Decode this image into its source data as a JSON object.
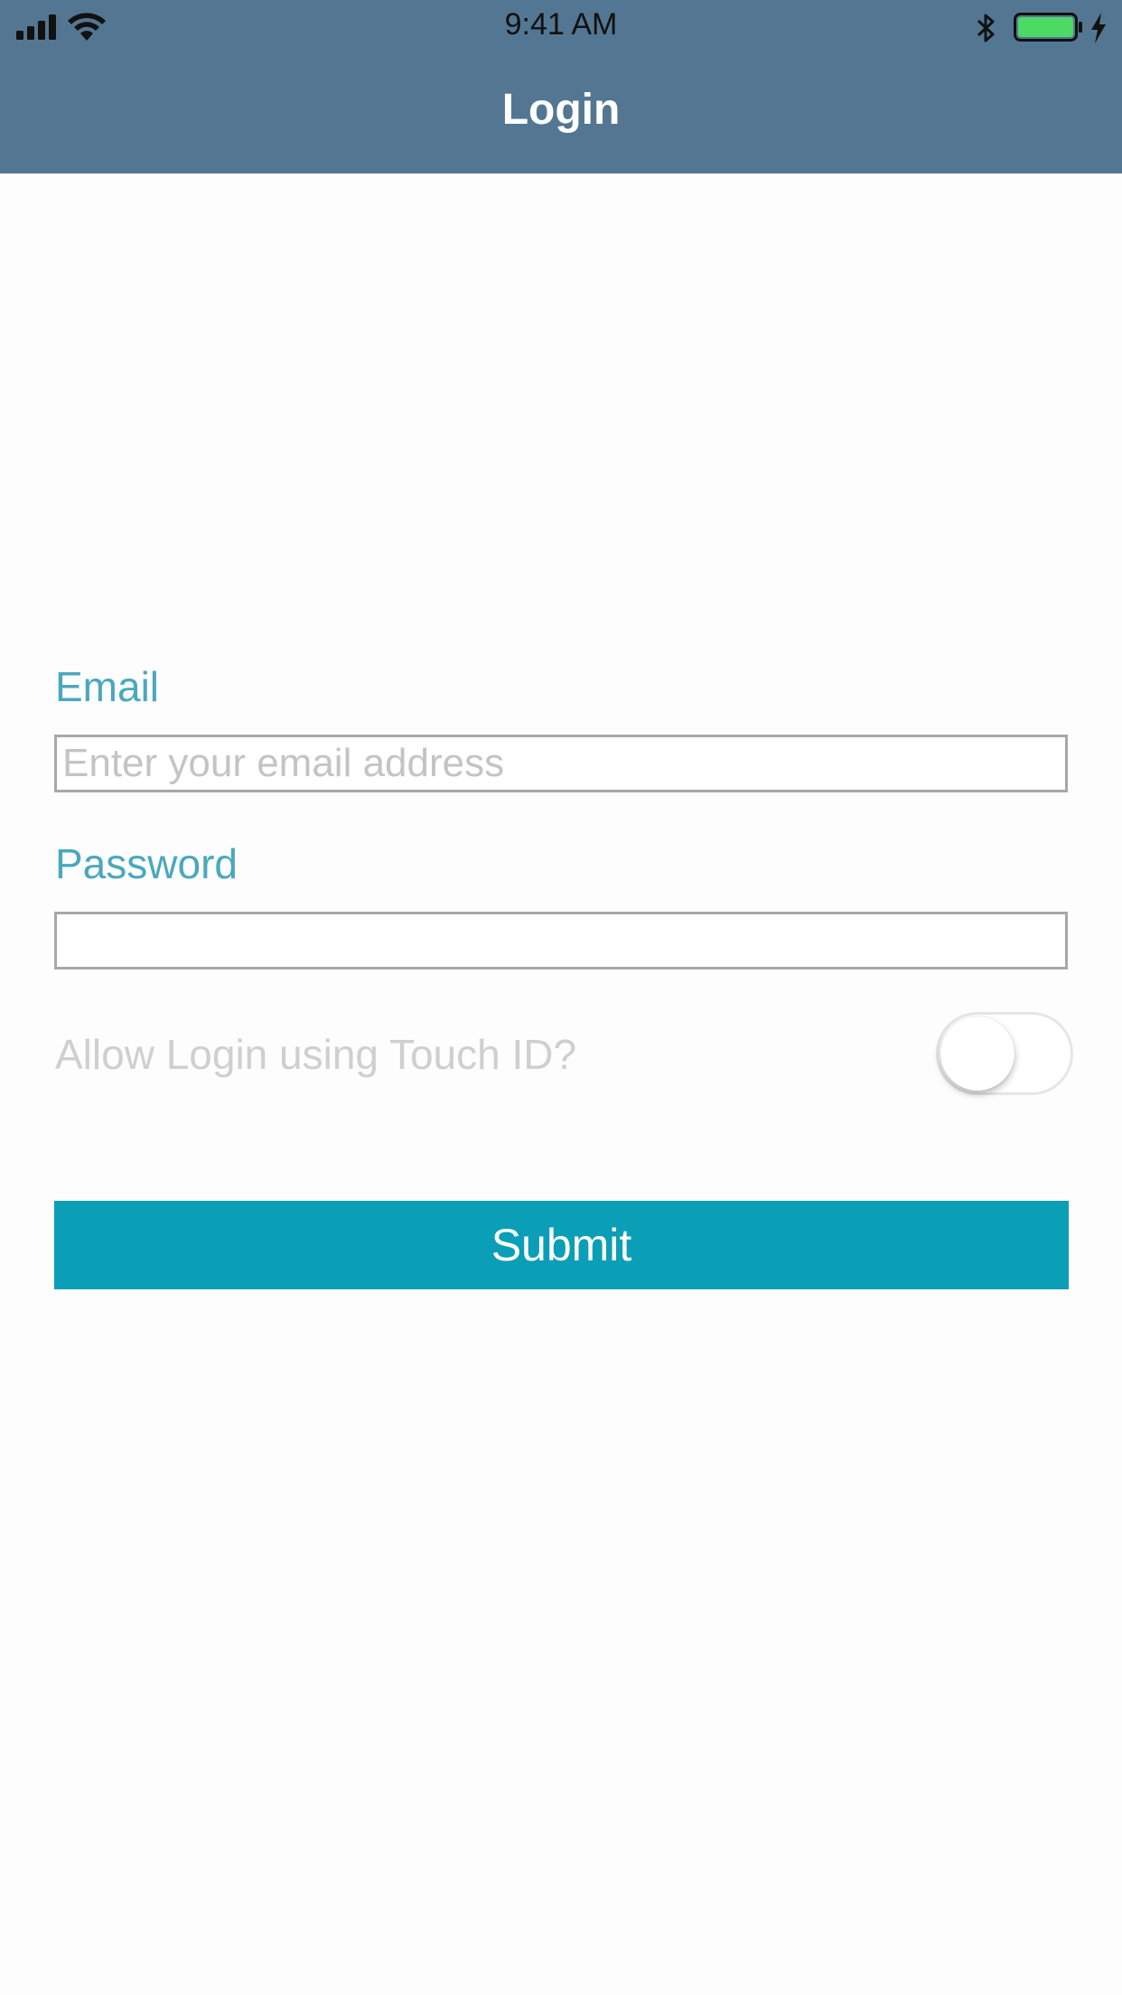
{
  "status_bar": {
    "time": "9:41 AM",
    "signal_icon": "cellular-signal-icon",
    "wifi_icon": "wifi-icon",
    "bluetooth_icon": "bluetooth-icon",
    "battery_icon": "battery-icon",
    "charging_icon": "charging-bolt-icon"
  },
  "nav": {
    "title": "Login"
  },
  "form": {
    "email_label": "Email",
    "email_placeholder": "Enter your email address",
    "email_value": "",
    "password_label": "Password",
    "password_value": "",
    "touch_id_label": "Allow Login using Touch ID?",
    "touch_id_enabled": false,
    "submit_label": "Submit"
  },
  "colors": {
    "navbar": "#537792",
    "label": "#4aa8bd",
    "button": "#0b9eb7",
    "battery_fill": "#4cd964"
  }
}
